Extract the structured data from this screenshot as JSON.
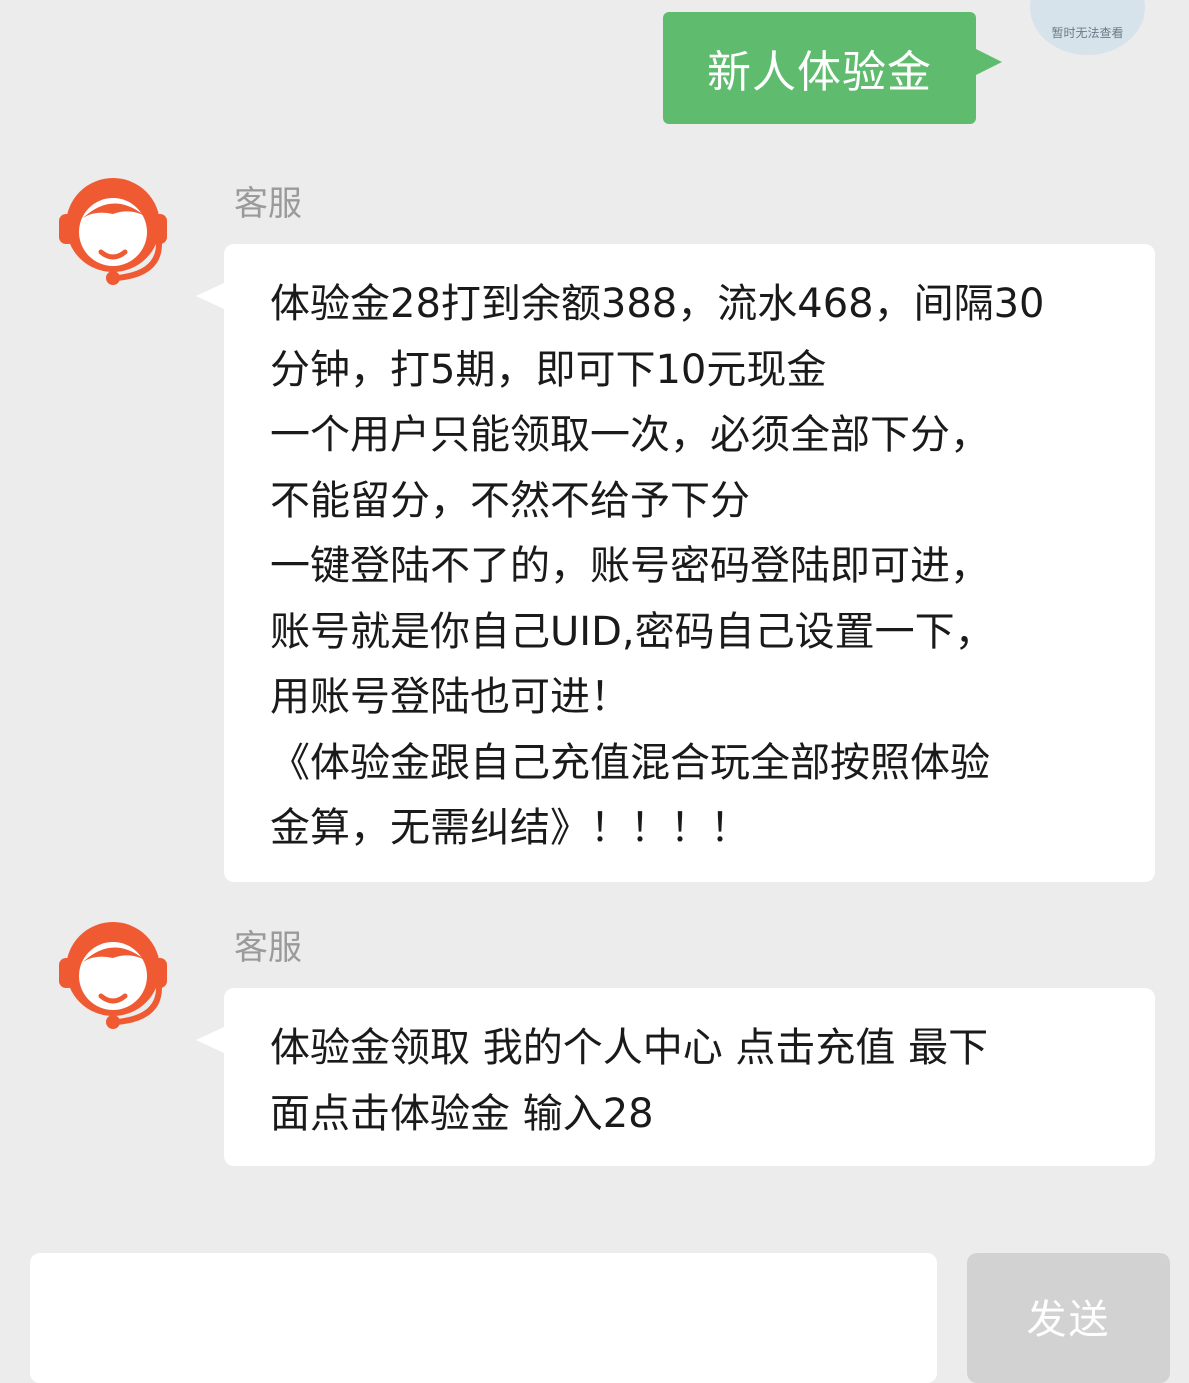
{
  "outgoing": {
    "text": "新人体验金",
    "avatar_caption": "暂时无法查看",
    "bubble_color": "#5fbb6e"
  },
  "messages": [
    {
      "sender": "客服",
      "avatar_icon": "customer-service-headset-icon",
      "lines": [
        "体验金28打到余额388，流水468，间隔30",
        "分钟，打5期，即可下10元现金",
        "一个用户只能领取一次，必须全部下分，",
        "不能留分，不然不给予下分",
        "一键登陆不了的，账号密码登陆即可进，",
        "账号就是你自己UID,密码自己设置一下，",
        "用账号登陆也可进！",
        "《体验金跟自己充值混合玩全部按照体验",
        "金算，无需纠结》！！！！"
      ]
    },
    {
      "sender": "客服",
      "avatar_icon": "customer-service-headset-icon",
      "lines": [
        "体验金领取 我的个人中心 点击充值 最下",
        "面点击体验金 输入28"
      ]
    }
  ],
  "composer": {
    "input_value": "",
    "send_label": "发送"
  },
  "colors": {
    "avatar_accent": "#f05a32",
    "background": "#ececec"
  }
}
